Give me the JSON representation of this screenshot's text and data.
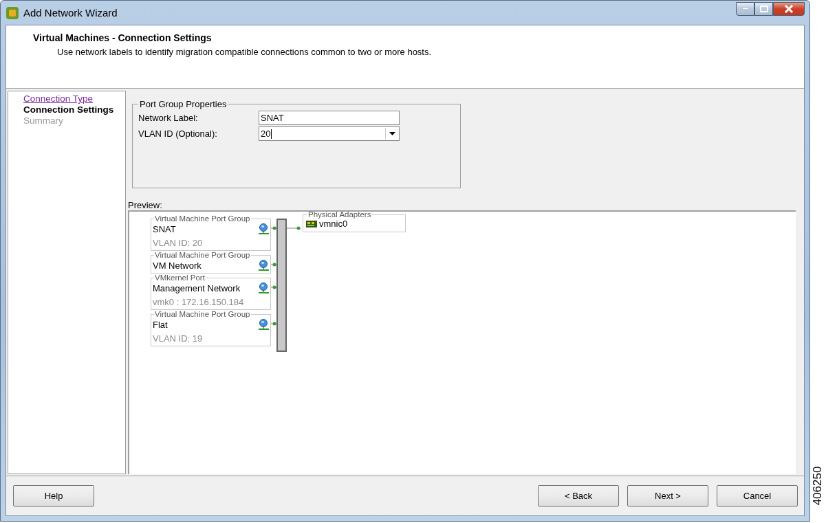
{
  "window": {
    "title": "Add Network Wizard"
  },
  "header": {
    "title": "Virtual Machines - Connection Settings",
    "description": "Use network labels to identify migration compatible connections common to two or more hosts."
  },
  "steps": [
    {
      "label": "Connection Type",
      "selected": false,
      "visited": true
    },
    {
      "label": "Connection Settings",
      "selected": true,
      "visited": false
    },
    {
      "label": "Summary",
      "selected": false,
      "visited": false
    }
  ],
  "port_group_properties": {
    "legend": "Port Group Properties",
    "fields": [
      {
        "label": "Network Label:",
        "value": "SNAT",
        "kind": "text"
      },
      {
        "label": "VLAN ID (Optional):",
        "value": "20",
        "kind": "combo"
      }
    ]
  },
  "preview": {
    "label": "Preview:",
    "port_groups": [
      {
        "type": "Virtual Machine Port Group",
        "name": "SNAT",
        "detail": "VLAN ID: 20"
      },
      {
        "type": "Virtual Machine Port Group",
        "name": "VM Network"
      },
      {
        "type": "VMkernel Port",
        "name": "Management Network",
        "detail": "vmk0 : 172.16.150.184"
      },
      {
        "type": "Virtual Machine Port Group",
        "name": "Flat",
        "detail": "VLAN ID: 19"
      }
    ],
    "adapters": {
      "legend": "Physical Adapters",
      "items": [
        "vmnic0"
      ]
    }
  },
  "buttons": [
    {
      "label": "Help",
      "kind": "left"
    },
    {
      "label": "< Back",
      "kind": "right"
    },
    {
      "label": "Next >",
      "kind": "right"
    },
    {
      "label": "Cancel",
      "kind": "right"
    }
  ],
  "figure_number": "406250"
}
